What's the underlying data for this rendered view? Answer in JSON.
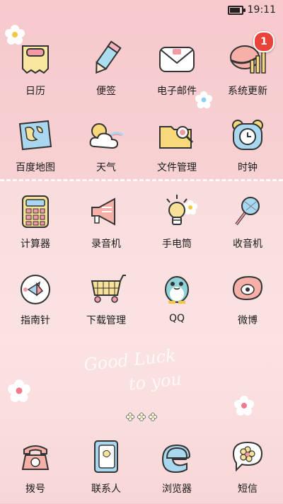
{
  "status": {
    "time": "19:11"
  },
  "apps": [
    {
      "label": "日历",
      "icon": "calendar-icon"
    },
    {
      "label": "便签",
      "icon": "notes-icon"
    },
    {
      "label": "电子邮件",
      "icon": "email-icon"
    },
    {
      "label": "系统更新",
      "icon": "system-update-icon",
      "badge": "1"
    },
    {
      "label": "百度地图",
      "icon": "map-icon"
    },
    {
      "label": "天气",
      "icon": "weather-icon"
    },
    {
      "label": "文件管理",
      "icon": "file-manager-icon"
    },
    {
      "label": "时钟",
      "icon": "clock-icon"
    },
    {
      "label": "计算器",
      "icon": "calculator-icon"
    },
    {
      "label": "录音机",
      "icon": "recorder-icon"
    },
    {
      "label": "手电筒",
      "icon": "flashlight-icon"
    },
    {
      "label": "收音机",
      "icon": "radio-icon"
    },
    {
      "label": "指南针",
      "icon": "compass-icon"
    },
    {
      "label": "下载管理",
      "icon": "download-manager-icon"
    },
    {
      "label": "QQ",
      "icon": "qq-icon"
    },
    {
      "label": "微博",
      "icon": "weibo-icon"
    }
  ],
  "dock": [
    {
      "label": "拨号",
      "icon": "phone-icon"
    },
    {
      "label": "联系人",
      "icon": "contacts-icon"
    },
    {
      "label": "浏览器",
      "icon": "browser-icon"
    },
    {
      "label": "短信",
      "icon": "messages-icon"
    }
  ],
  "wallpaper_text": {
    "line1": "Good Luck",
    "line2": "to you"
  }
}
